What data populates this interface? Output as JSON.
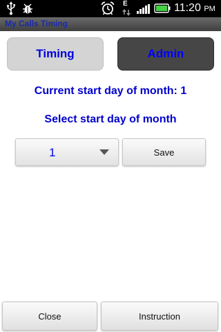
{
  "status_bar": {
    "time": "11:20",
    "ampm": "PM",
    "data_indicator": "E",
    "icons": [
      "usb-icon",
      "bug-icon",
      "alarm-clock-icon",
      "data-arrows-icon",
      "signal-bars-icon",
      "battery-icon"
    ]
  },
  "app": {
    "title": "My Calls Timing"
  },
  "tabs": {
    "timing_label": "Timing",
    "admin_label": "Admin"
  },
  "main": {
    "current_start_day_text": "Current start day of month: 1",
    "select_label": "Select start day of month",
    "spinner_value": "1",
    "save_label": "Save"
  },
  "footer": {
    "close_label": "Close",
    "instruction_label": "Instruction"
  },
  "colors": {
    "accent_text": "#0000cc",
    "admin_tab_bg": "#464646",
    "timing_tab_bg": "#d4d4d4",
    "title_bar": "#555555"
  }
}
